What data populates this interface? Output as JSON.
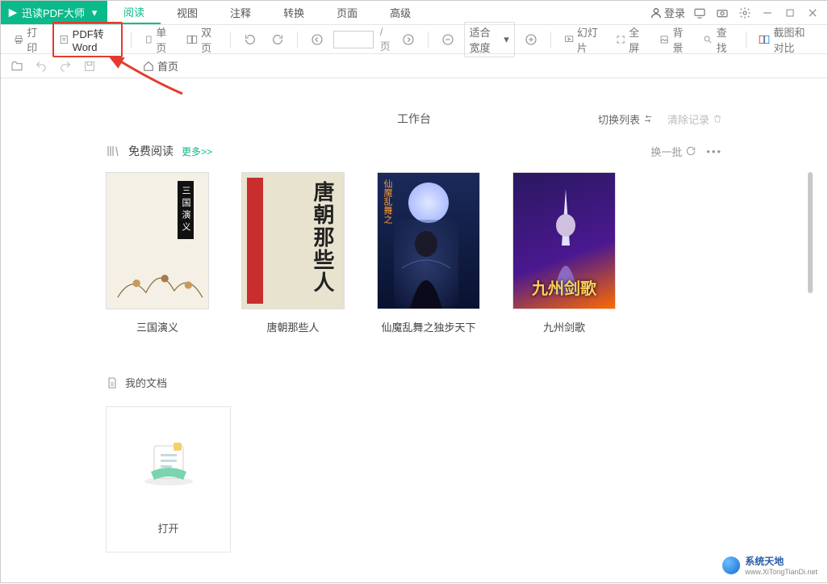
{
  "app": {
    "title": "迅读PDF大师"
  },
  "menu": {
    "items": [
      "阅读",
      "视图",
      "注释",
      "转换",
      "页面",
      "高级"
    ],
    "login": "登录"
  },
  "toolbar": {
    "print": "打印",
    "pdf_to_word": "PDF转Word",
    "single_page": "单页",
    "dual_page": "双页",
    "page_sep": "/页",
    "fit_width": "适合宽度",
    "slideshow": "幻灯片",
    "fullscreen": "全屏",
    "background": "背景",
    "find": "查找",
    "compare": "截图和对比"
  },
  "quickbar": {
    "home": "首页"
  },
  "workspace": {
    "title": "工作台",
    "switch_list": "切换列表",
    "clear_history": "清除记录"
  },
  "free_read": {
    "title": "免费阅读",
    "more": "更多>>",
    "refresh": "换一批",
    "books": [
      {
        "title": "三国演义",
        "cover_text": "三国演义"
      },
      {
        "title": "唐朝那些人",
        "cover_text": "唐朝那些人"
      },
      {
        "title": "仙魔乱舞之独步天下",
        "cover_text": "仙魔乱舞之"
      },
      {
        "title": "九州剑歌",
        "cover_text": "九州剑歌"
      }
    ]
  },
  "mydoc": {
    "title": "我的文档",
    "open": "打开"
  },
  "watermark": {
    "title": "系统天地",
    "sub": "www.XiTongTianDi.net"
  }
}
